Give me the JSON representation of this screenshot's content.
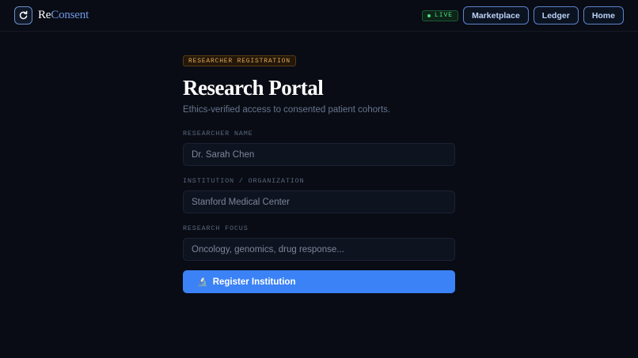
{
  "header": {
    "brand_prefix": "Re",
    "brand_suffix": "Consent",
    "live_label": "LIVE",
    "nav": [
      "Marketplace",
      "Ledger",
      "Home"
    ]
  },
  "form": {
    "eyebrow": "RESEARCHER REGISTRATION",
    "title": "Research Portal",
    "subtitle": "Ethics-verified access to consented patient cohorts.",
    "fields": [
      {
        "label": "RESEARCHER NAME",
        "placeholder": "Dr. Sarah Chen"
      },
      {
        "label": "INSTITUTION / ORGANIZATION",
        "placeholder": "Stanford Medical Center"
      },
      {
        "label": "RESEARCH FOCUS",
        "placeholder": "Oncology, genomics, drug response..."
      }
    ],
    "submit_icon": "🔬",
    "submit_label": "Register Institution"
  },
  "colors": {
    "background": "#090c14",
    "accent": "#3b82f6",
    "live": "#4ade80",
    "eyebrow": "#e0a354"
  },
  "icons": {
    "logo": "refresh-cycle-icon",
    "submit": "microscope-icon"
  }
}
